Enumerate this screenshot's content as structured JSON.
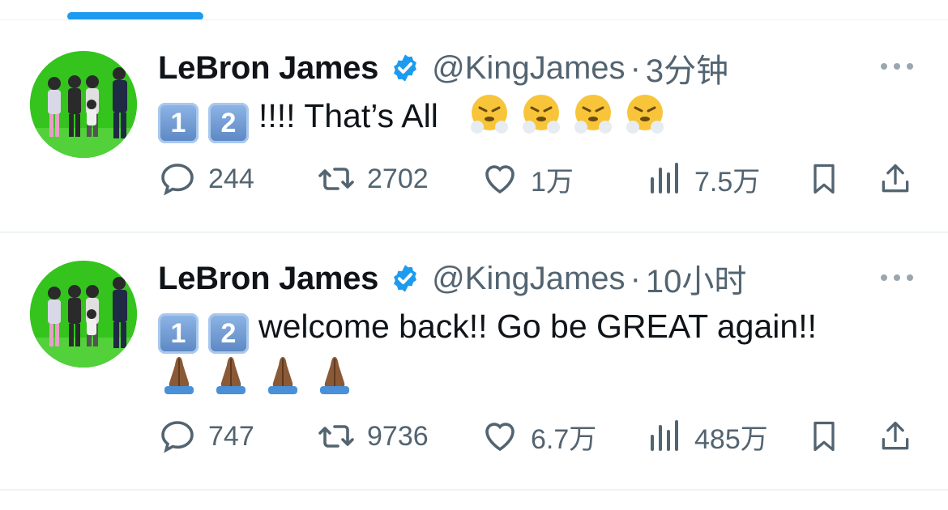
{
  "colors": {
    "accent": "#1d9bf0",
    "muted": "#536471",
    "text": "#0f1419",
    "avatar_bg": "#35c41e"
  },
  "tweets": [
    {
      "name": "LeBron James",
      "handle": "@KingJames",
      "separator": "·",
      "time": "3分钟",
      "keycaps": [
        "1",
        "2"
      ],
      "text": "!!!! That’s All",
      "emojis": [
        "huffing-face",
        "huffing-face",
        "huffing-face",
        "huffing-face"
      ],
      "stats": {
        "replies": "244",
        "retweets": "2702",
        "likes": "1万",
        "views": "7.5万"
      }
    },
    {
      "name": "LeBron James",
      "handle": "@KingJames",
      "separator": "·",
      "time": "10小时",
      "keycaps": [
        "1",
        "2"
      ],
      "text": "welcome back!! Go be GREAT again!!",
      "emojis": [
        "folded-hands",
        "folded-hands",
        "folded-hands",
        "folded-hands"
      ],
      "stats": {
        "replies": "747",
        "retweets": "9736",
        "likes": "6.7万",
        "views": "485万"
      }
    }
  ]
}
